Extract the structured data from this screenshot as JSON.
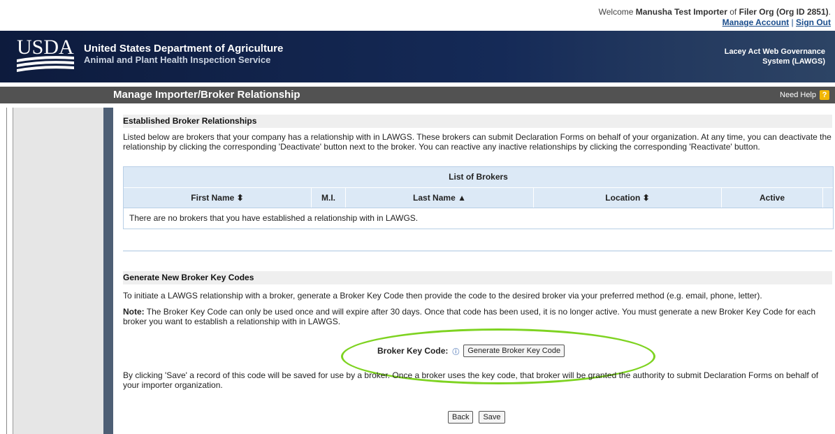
{
  "account": {
    "welcome_prefix": "Welcome",
    "user_name": "Manusha Test Importer",
    "of_text": "of",
    "org_name": "Filer Org (Org ID 2851)",
    "trailing": ".",
    "manage_account_label": "Manage Account",
    "separator": "|",
    "sign_out_label": "Sign Out"
  },
  "banner": {
    "logo_text": "USDA",
    "agency_line1": "United States Department of Agriculture",
    "agency_line2": "Animal and Plant Health Inspection Service",
    "system_line1": "Lacey Act Web Governance",
    "system_line2": "System (LAWGS)"
  },
  "titlebar": {
    "page_title": "Manage Importer/Broker Relationship",
    "help_label": "Need Help",
    "help_icon_glyph": "?"
  },
  "established": {
    "heading": "Established Broker Relationships",
    "description": "Listed below are brokers that your company has a relationship with in LAWGS. These brokers can submit Declaration Forms on behalf of your organization. At any time, you can deactivate the relationship by clicking the corresponding 'Deactivate' button next to the broker. You can reactive any inactive relationships by clicking the corresponding 'Reactivate' button."
  },
  "broker_table": {
    "caption": "List of Brokers",
    "columns": [
      "First Name ⬍",
      "M.I.",
      "Last Name ▲",
      "Location ⬍",
      "Active"
    ],
    "empty_message": "There are no brokers that you have established a relationship with in LAWGS."
  },
  "generate": {
    "heading": "Generate New Broker Key Codes",
    "intro": "To initiate a LAWGS relationship with a broker, generate a Broker Key Code then provide the code to the desired broker via your preferred method (e.g. email, phone, letter).",
    "note_label": "Note:",
    "note_text": " The Broker Key Code can only be used once and will expire after 30 days. Once that code has been used, it is no longer active. You must generate a new Broker Key Code for each broker you want to establish a relationship with in LAWGS.",
    "key_code_label": "Broker Key Code:",
    "info_icon_glyph": "ⓘ",
    "generate_button_label": "Generate Broker Key Code",
    "save_notice": "By clicking 'Save' a record of this code will be saved for use by a broker. Once a broker uses the key code, that broker will be granted the authority to submit Declaration Forms on behalf of your importer organization."
  },
  "actions": {
    "back_label": "Back",
    "save_label": "Save"
  },
  "colors": {
    "banner": "#0d1b3d",
    "titlebar": "#525252",
    "table_header": "#dce9f6",
    "highlight_ellipse": "#7ed321",
    "help_icon": "#f2b705"
  }
}
